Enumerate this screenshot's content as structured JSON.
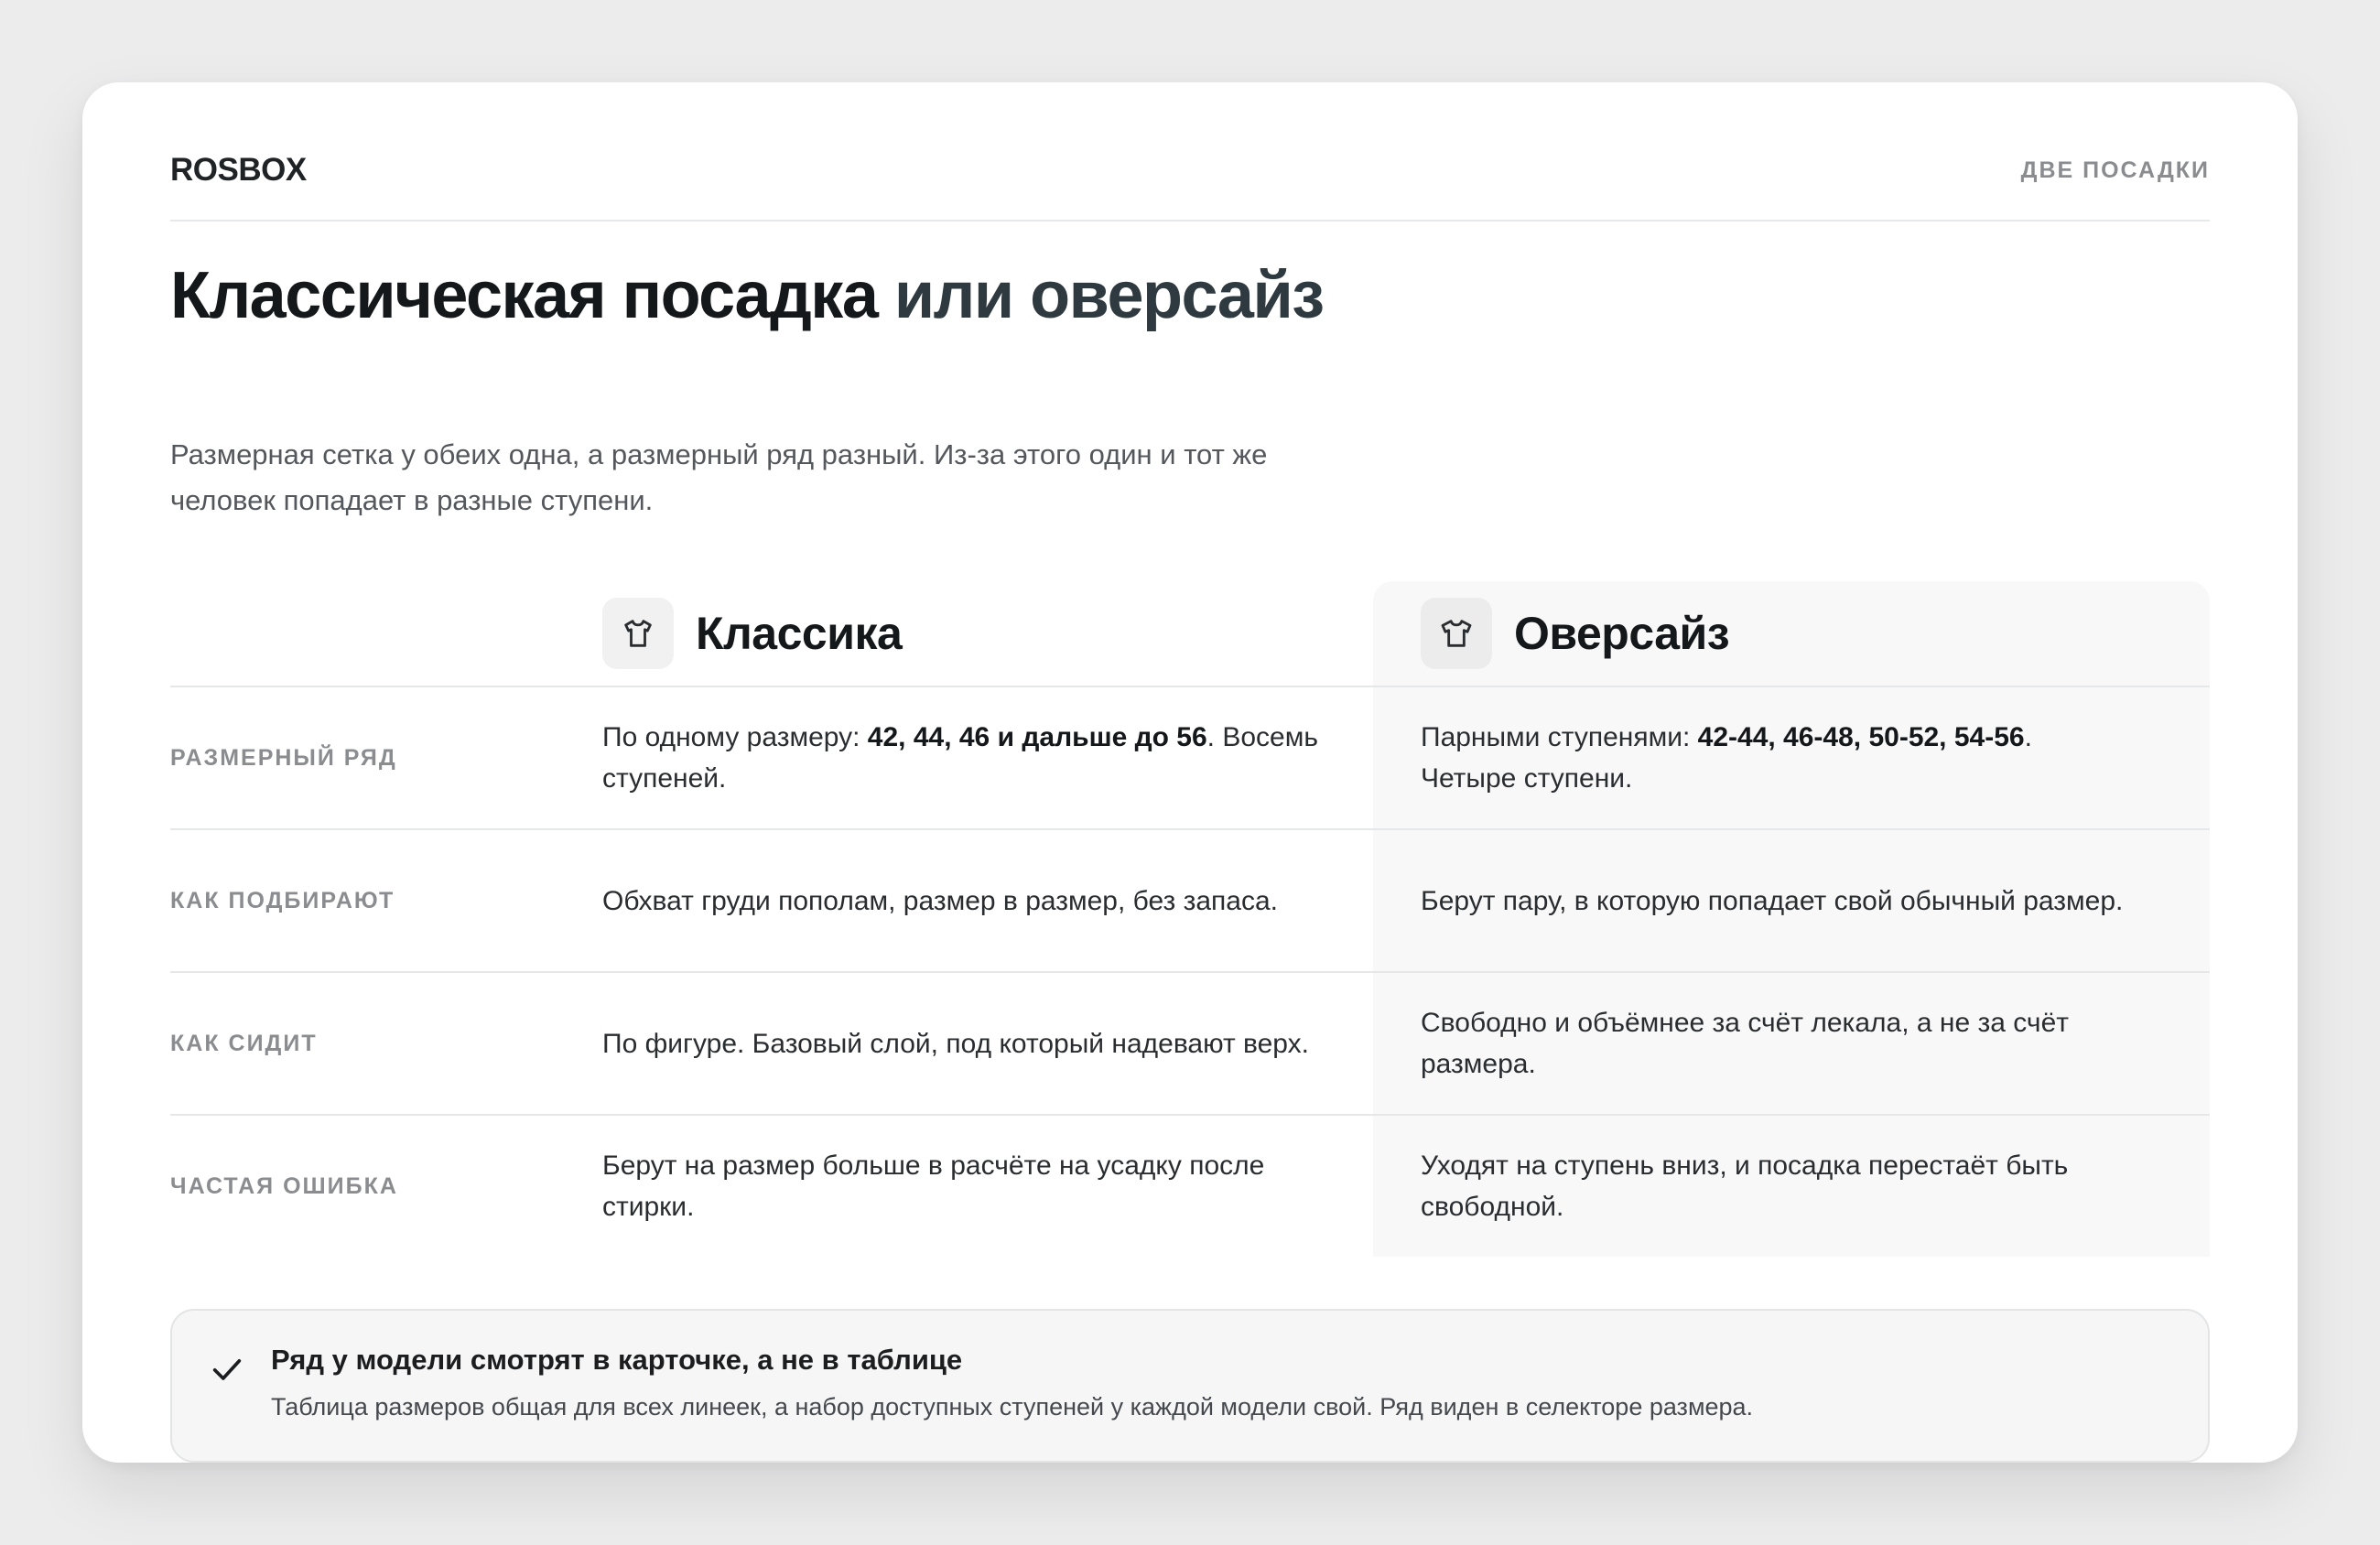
{
  "header": {
    "brand": "ROSBOX",
    "tag": "ДВЕ ПОСАДКИ"
  },
  "hero": {
    "title_part1": "Классическая посадка",
    "title_part2": "или оверсайз",
    "subtitle": "Размерная сетка у обеих одна, а размерный ряд разный. Из-за этого один и тот же человек попадает в разные ступени."
  },
  "columns": {
    "classic": {
      "title": "Классика",
      "icon": "tshirt-icon"
    },
    "oversize": {
      "title": "Оверсайз",
      "icon": "tshirt-icon"
    }
  },
  "rows": [
    {
      "label": "РАЗМЕРНЫЙ РЯД",
      "classic": {
        "pre": "По одному размеру: ",
        "bold": "42, 44, 46 и дальше до 56",
        "post": ". Восемь ступеней."
      },
      "oversize": {
        "pre": "Парными ступенями: ",
        "bold": "42-44, 46-48, 50-52, 54-56",
        "post": ". Четыре ступени."
      }
    },
    {
      "label": "КАК ПОДБИРАЮТ",
      "classic": {
        "text": "Обхват груди пополам, размер в размер, без запаса."
      },
      "oversize": {
        "text": "Берут пару, в которую попадает свой обычный размер."
      }
    },
    {
      "label": "КАК СИДИТ",
      "classic": {
        "text": "По фигуре. Базовый слой, под который надевают верх."
      },
      "oversize": {
        "text": "Свободно и объёмнее за счёт лекала, а не за счёт размера."
      }
    },
    {
      "label": "ЧАСТАЯ ОШИБКА",
      "classic": {
        "text": "Берут на размер больше в расчёте на усадку после стирки."
      },
      "oversize": {
        "text": "Уходят на ступень вниз, и посадка перестаёт быть свободной."
      }
    }
  ],
  "note": {
    "icon": "check-icon",
    "title": "Ряд у модели смотрят в карточке, а не в таблице",
    "text": "Таблица размеров общая для всех линеек, а набор доступных ступеней у каждой модели свой. Ряд виден в селекторе размера."
  }
}
